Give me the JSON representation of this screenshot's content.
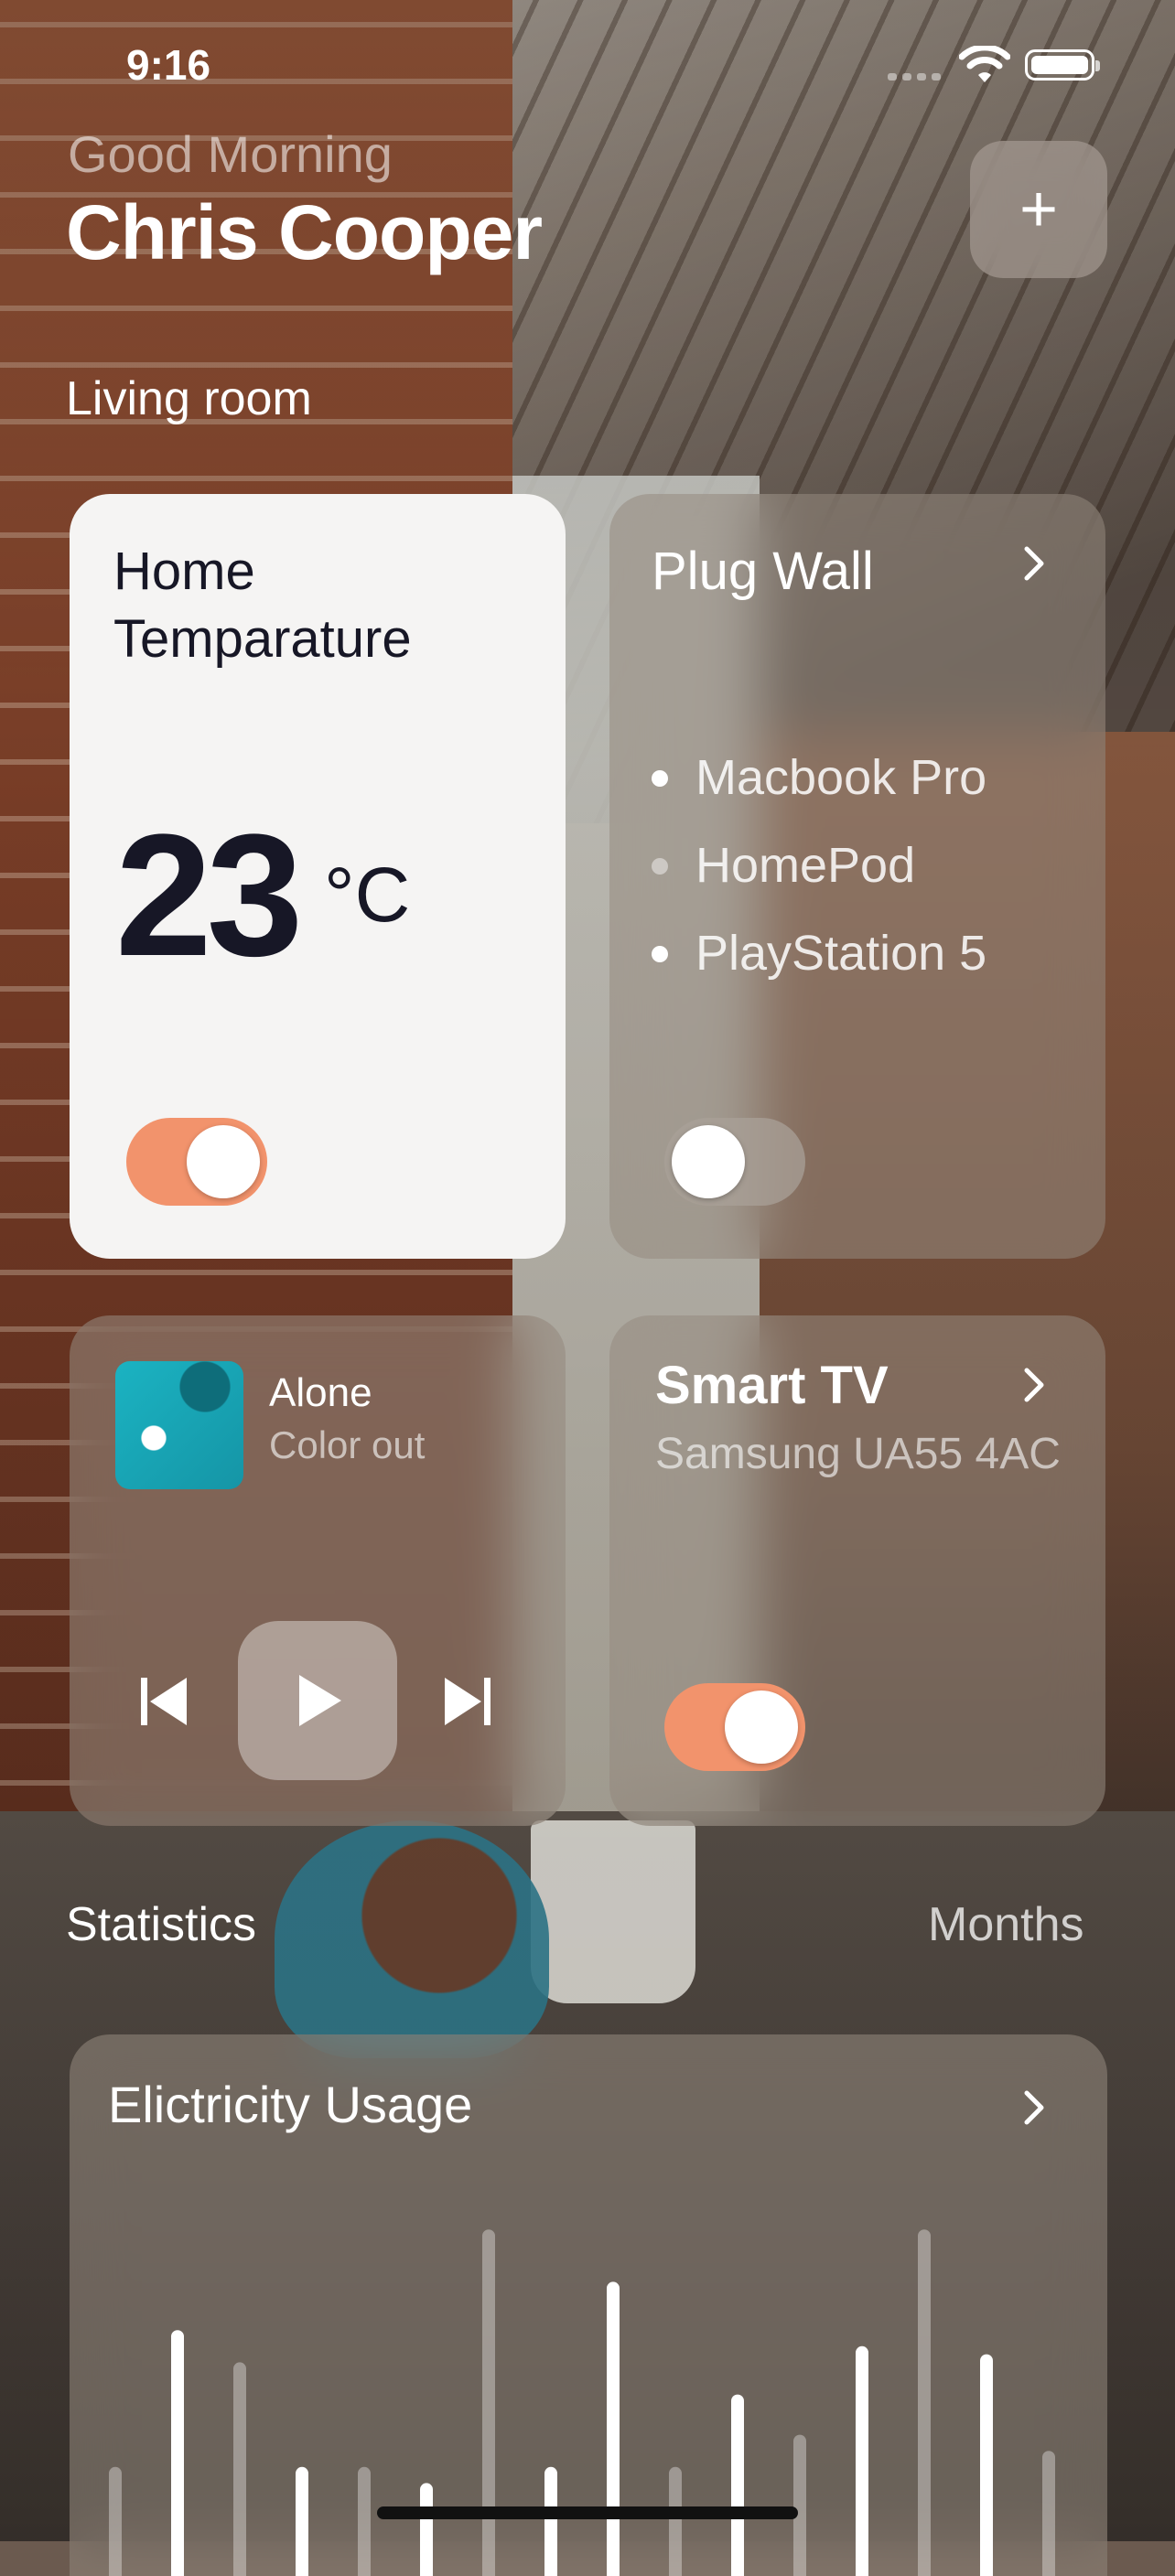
{
  "status_bar": {
    "time": "9:16"
  },
  "header": {
    "greeting": "Good Morning",
    "user_name": "Chris Cooper",
    "add_button": "+"
  },
  "living_room": {
    "title": "Living room",
    "temperature_card": {
      "title_line1": "Home",
      "title_line2": "Temparature",
      "value": "23",
      "unit": "°C",
      "toggle_on": true
    },
    "plug_card": {
      "title": "Plug Wall",
      "devices": [
        {
          "name": "Macbook Pro",
          "active": true
        },
        {
          "name": "HomePod",
          "active": false
        },
        {
          "name": "PlayStation 5",
          "active": true
        }
      ],
      "toggle_on": false
    },
    "music_card": {
      "song": "Alone",
      "artist": "Color out",
      "icons": [
        "previous-icon",
        "play-icon",
        "next-icon"
      ]
    },
    "tv_card": {
      "title": "Smart TV",
      "model": "Samsung UA55 4AC",
      "toggle_on": true
    }
  },
  "statistics": {
    "title": "Statistics",
    "period": "Months",
    "chart_card_title": "Elictricity Usage"
  },
  "chart_data": {
    "type": "bar",
    "title": "Elictricity Usage",
    "values": [
      0.18,
      0.52,
      0.44,
      0.18,
      0.18,
      0.14,
      0.77,
      0.18,
      0.64,
      0.18,
      0.36,
      0.26,
      0.48,
      0.77,
      0.46,
      0.22
    ],
    "highlight": [
      false,
      true,
      false,
      true,
      false,
      true,
      false,
      true,
      true,
      false,
      true,
      false,
      true,
      false,
      true,
      false
    ]
  },
  "colors": {
    "accent": "#f2936c",
    "card_light": "#f5f4f3",
    "text_dark": "#171726"
  }
}
